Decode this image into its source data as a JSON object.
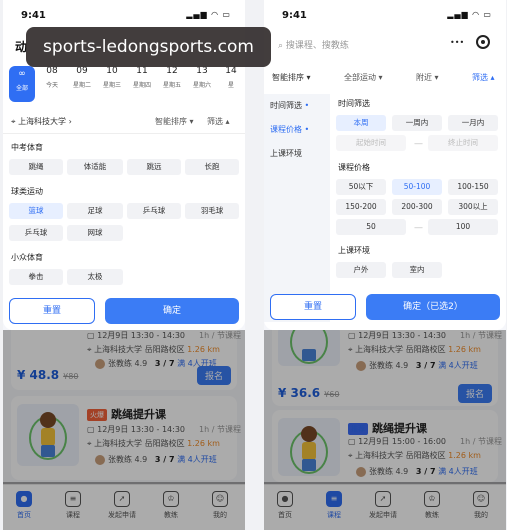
{
  "left": {
    "status": {
      "time": "9:41"
    },
    "header_title": "动",
    "dates": [
      {
        "day": "",
        "label": "全部",
        "icon": "infinity-icon",
        "selected": true
      },
      {
        "day": "08",
        "label": "今天"
      },
      {
        "day": "09",
        "label": "星期二"
      },
      {
        "day": "10",
        "label": "星期三"
      },
      {
        "day": "11",
        "label": "星期四"
      },
      {
        "day": "12",
        "label": "星期五"
      },
      {
        "day": "13",
        "label": "星期六"
      },
      {
        "day": "14",
        "label": "星"
      }
    ],
    "location": "上海科技大学",
    "sort_label": "智能排序",
    "filter_label": "筛选",
    "sections": {
      "s1": {
        "title": "中考体育",
        "chips": [
          "跳绳",
          "体适能",
          "跳远",
          "长跑"
        ]
      },
      "s2": {
        "title": "球类运动",
        "chips": [
          "篮球",
          "足球",
          "乒乓球",
          "羽毛球",
          "乒乓球",
          "网球"
        ]
      },
      "s3": {
        "title": "小众体育",
        "chips": [
          "拳击",
          "太极"
        ]
      }
    },
    "reset_label": "重置",
    "confirm_label": "确定",
    "card1": {
      "date_line": "12月9日 13:30 - 14:30",
      "per": "1h / 节课程",
      "place": "上海科技大学 岳阳路校区",
      "dist": "1.26 km",
      "coach": "张教练",
      "rating": "4.9",
      "progress": "3 / 7",
      "start": "满 4人开班",
      "price": "¥ 48.8",
      "old_price": "¥80",
      "enroll": "报名"
    },
    "card2": {
      "tag": "火爆",
      "title": "跳绳提升课",
      "date_line": "12月9日 13:30 - 14:30",
      "per": "1h / 节课程",
      "place": "上海科技大学 岳阳路校区",
      "dist": "1.26 km",
      "coach": "张教练",
      "rating": "4.9",
      "progress": "3 / 7",
      "start": "满 4人开班"
    }
  },
  "right": {
    "status": {
      "time": "9:41"
    },
    "search_placeholder": "搜课程、搜教练",
    "menu_dots": "•••",
    "filters": {
      "sort": "智能排序",
      "sport": "全部运动",
      "near": "附近",
      "filter": "筛选"
    },
    "side_items": [
      "时间筛选",
      "课程价格",
      "上课环境"
    ],
    "time": {
      "title": "时间筛选",
      "chips": [
        "本周",
        "一周内",
        "一月内"
      ],
      "start_ph": "起始时间",
      "end_ph": "终止时间"
    },
    "price": {
      "title": "课程价格",
      "chips": [
        "50以下",
        "50-100",
        "100-150",
        "150-200",
        "200-300",
        "300以上"
      ],
      "min": "50",
      "max": "100"
    },
    "env": {
      "title": "上课环境",
      "chips": [
        "户外",
        "室内"
      ]
    },
    "reset_label": "重置",
    "confirm_label": "确定（已选2）",
    "card1": {
      "date_line": "12月9日 13:30 - 14:30",
      "per": "1h / 节课程",
      "place": "上海科技大学 岳阳路校区",
      "dist": "1.26 km",
      "coach": "张教练",
      "rating": "4.9",
      "progress": "3 / 7",
      "start": "满 4人开班",
      "price": "¥ 36.6",
      "old_price": "¥60",
      "enroll": "报名"
    },
    "card2": {
      "tag": "推荐",
      "title": "跳绳提升课",
      "date_line": "12月9日 15:00 - 16:00",
      "per": "1h / 节课程",
      "place": "上海科技大学 岳阳路校区",
      "dist": "1.26 km",
      "coach": "张教练",
      "rating": "4.9",
      "progress": "3 / 7",
      "start": "满 4人开班"
    }
  },
  "tabs": [
    {
      "label": "首页",
      "icon": "planet-icon"
    },
    {
      "label": "课程",
      "icon": "document-icon"
    },
    {
      "label": "发起申请",
      "icon": "rocket-icon"
    },
    {
      "label": "教练",
      "icon": "trophy-icon"
    },
    {
      "label": "我的",
      "icon": "user-icon"
    }
  ],
  "watermark": "sports-ledongsports.com",
  "colors": {
    "accent": "#2f6ef3",
    "distance": "#f08c2a"
  }
}
